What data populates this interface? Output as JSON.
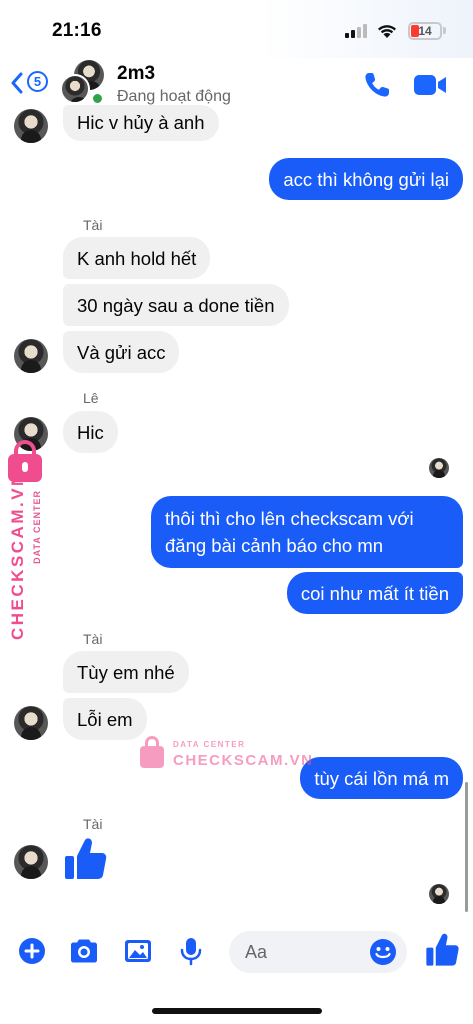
{
  "status_bar": {
    "time": "21:16",
    "battery": "14"
  },
  "header": {
    "back_count": "5",
    "contact_name": "2m3",
    "status": "Đang hoạt động"
  },
  "messages": [
    {
      "type": "received",
      "text": "Hic v hủy à anh"
    },
    {
      "type": "sent",
      "text": "acc thì không gửi lại"
    },
    {
      "type": "sender",
      "text": "Tài"
    },
    {
      "type": "received",
      "text": "K anh hold hết"
    },
    {
      "type": "received",
      "text": "30 ngày sau a done tiền"
    },
    {
      "type": "received",
      "text": "Và gửi acc"
    },
    {
      "type": "sender",
      "text": "Lê"
    },
    {
      "type": "received",
      "text": "Hic"
    },
    {
      "type": "sent",
      "text": "thôi thì cho lên checkscam với"
    },
    {
      "type": "sent",
      "text": "đăng bài cảnh báo cho mn"
    },
    {
      "type": "sent",
      "text": "coi như mất ít tiền"
    },
    {
      "type": "sender",
      "text": "Tài"
    },
    {
      "type": "received",
      "text": "Tùy em nhé"
    },
    {
      "type": "received",
      "text": "Lỗi em"
    },
    {
      "type": "sent",
      "text": "tùy cái lồn má m"
    },
    {
      "type": "sender",
      "text": "Tài"
    },
    {
      "type": "received",
      "text": "thumbs-up-icon"
    }
  ],
  "watermark": {
    "small_text": "DATA CENTER",
    "big_text": "CHECKSCAM.VN"
  },
  "composer": {
    "placeholder": "Aa"
  },
  "colors": {
    "accent": "#1a5cf8",
    "received_bubble": "#f0f0f0",
    "online": "#31a24c",
    "watermark": "#f04d8f"
  }
}
